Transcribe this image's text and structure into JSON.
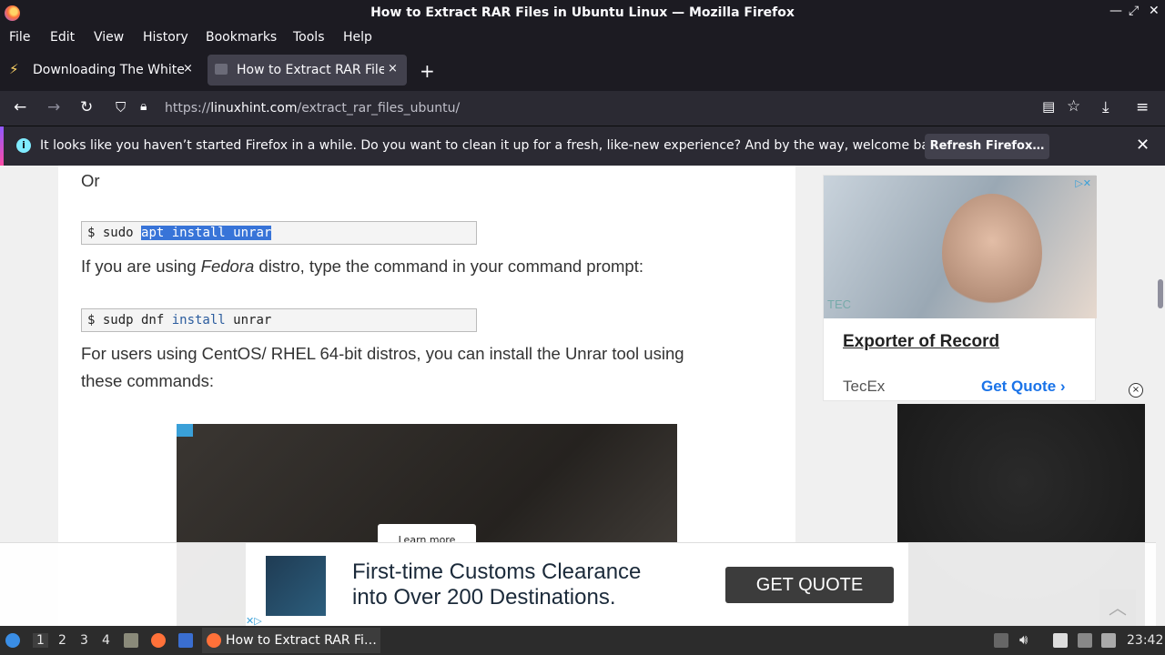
{
  "window": {
    "title": "How to Extract RAR Files in Ubuntu Linux — Mozilla Firefox",
    "controls": [
      "minimize-icon",
      "maximize-icon",
      "close-icon"
    ]
  },
  "menubar": {
    "items": [
      "File",
      "Edit",
      "View",
      "History",
      "Bookmarks",
      "Tools",
      "Help"
    ]
  },
  "tabs": [
    {
      "label": "Downloading The White House",
      "active": false,
      "close": "×"
    },
    {
      "label": "How to Extract RAR Files",
      "active": true,
      "close": "×"
    }
  ],
  "newtab": "+",
  "navbar": {
    "url_prefix": "https://",
    "url_domain": "linuxhint.com",
    "url_path": "/extract_rar_files_ubuntu/"
  },
  "notification": {
    "message": "It looks like you haven’t started Firefox in a while. Do you want to clean it up for a fresh, like-new experience? And by the way, welcome back!",
    "button": "Refresh Firefox…",
    "close": "✕"
  },
  "article": {
    "or_text": "Or",
    "cmd1": {
      "prompt": "$ sudo ",
      "selected": "apt install unrar"
    },
    "fedora_pre": "If you are using ",
    "fedora_em": "Fedora",
    "fedora_post": " distro, type the command in your command prompt:",
    "cmd2": {
      "prompt": "$ sudp dnf ",
      "kw": "install",
      "rest": " unrar"
    },
    "centos_line1": "For users using CentOS/ RHEL 64-bit distros, you can install the Unrar tool using",
    "centos_line2": "these commands:",
    "video_learn": "Learn more"
  },
  "side_ad": {
    "headline": "Exporter of Record",
    "brand": "TecEx",
    "cta": "Get Quote ›",
    "watermark": "TEC",
    "adchoice": "▷✕"
  },
  "ad_close": "×",
  "banner_ad": {
    "line1": "First-time Customs Clearance",
    "line2": "into Over 200 Destinations.",
    "cta": "GET QUOTE",
    "adchoice": "✕▷"
  },
  "taskbar": {
    "workspaces": [
      "1",
      "2",
      "3",
      "4"
    ],
    "task_label": "How to Extract RAR Fi…",
    "clock": "23:42"
  }
}
